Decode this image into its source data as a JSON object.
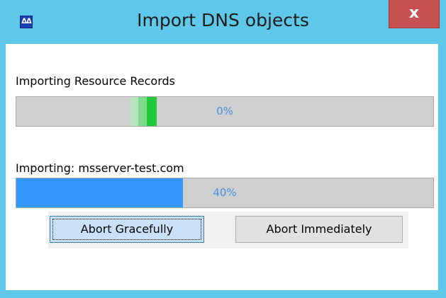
{
  "window": {
    "title": "Import DNS objects",
    "app_icon_glyph": "ᐃᐃ",
    "close_glyph": "x",
    "accent_color": "#5fc8ea",
    "close_color": "#c75050"
  },
  "progress_records": {
    "label": "Importing Resource Records",
    "percent_text": "0%",
    "value": 0
  },
  "progress_zone": {
    "label": "Importing: msserver-test.com",
    "percent_text": "40%",
    "value": 0.4
  },
  "buttons": {
    "abort_gracefully": "Abort Gracefully",
    "abort_immediately": "Abort Immediately"
  }
}
